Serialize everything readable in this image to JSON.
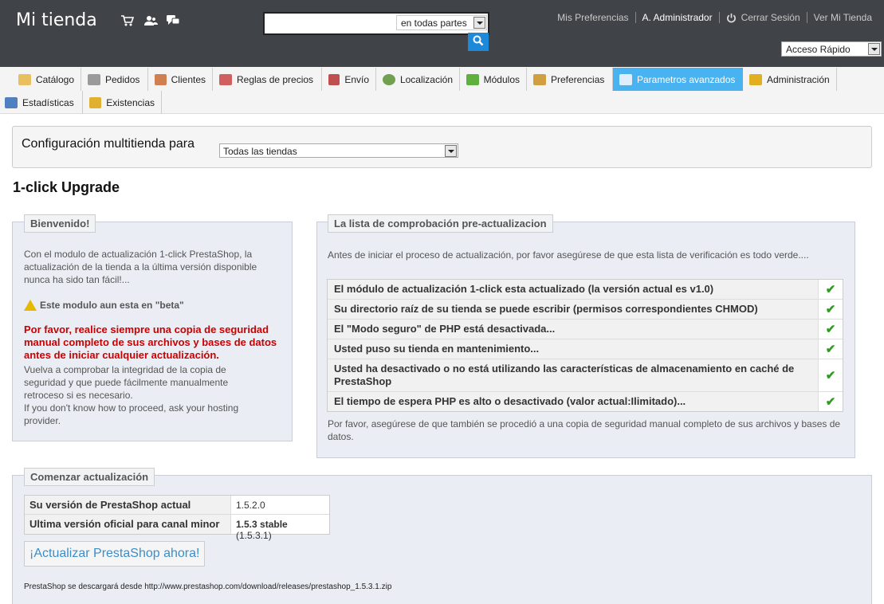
{
  "header": {
    "shop_name": "Mi tienda",
    "search": {
      "placeholder": "",
      "scope": "en todas partes"
    },
    "links": {
      "preferences": "Mis Preferencias",
      "admin": "A. Administrador",
      "logout": "Cerrar Sesión",
      "view_shop": "Ver Mi Tienda"
    },
    "quick_access": "Acceso Rápido"
  },
  "nav": {
    "tabs": [
      {
        "label": "Catálogo",
        "icon": "folder-icon",
        "color": "#e8c060"
      },
      {
        "label": "Pedidos",
        "icon": "cart-icon",
        "color": "#9a9a9a"
      },
      {
        "label": "Clientes",
        "icon": "user-icon",
        "color": "#d08050"
      },
      {
        "label": "Reglas de precios",
        "icon": "price-rules-icon",
        "color": "#d06060"
      },
      {
        "label": "Envío",
        "icon": "truck-icon",
        "color": "#c05050"
      },
      {
        "label": "Localización",
        "icon": "globe-icon",
        "color": "#70a050"
      },
      {
        "label": "Módulos",
        "icon": "puzzle-icon",
        "color": "#60b040"
      },
      {
        "label": "Preferencias",
        "icon": "preferences-icon",
        "color": "#d0a040"
      },
      {
        "label": "Parametros avanzados",
        "icon": "wrench-icon",
        "color": "#e0eefc"
      },
      {
        "label": "Administración",
        "icon": "key-icon",
        "color": "#e0b020"
      },
      {
        "label": "Estadísticas",
        "icon": "stats-icon",
        "color": "#5080c0"
      },
      {
        "label": "Existencias",
        "icon": "stock-icon",
        "color": "#e0b030"
      }
    ]
  },
  "multishop": {
    "label": "Configuración multitienda para",
    "selected": "Todas las tiendas"
  },
  "page_title": "1-click Upgrade",
  "welcome": {
    "legend": "Bienvenido!",
    "intro": "Con el modulo de actualización 1-click PrestaShop, la actualización de la tienda a la última versión disponible nunca ha sido tan fácil!...",
    "beta": "Este modulo aun esta en \"beta\"",
    "warning": "Por favor, realice siempre una copia de seguridad manual completo de sus archivos y bases de datos antes de iniciar cualquier actualización.",
    "check_integrity": "Vuelva a comprobar la integridad de la copia de seguridad y que puede fácilmente manualmente retroceso si es necesario.",
    "help": "If you don't know how to proceed, ask your hosting provider."
  },
  "checklist": {
    "legend": "La lista de comprobación pre-actualizacion",
    "intro": "Antes de iniciar el proceso de actualización, por favor asegúrese de que esta lista de verificación es todo verde....",
    "items": [
      {
        "text": "El módulo de actualización 1-click esta actualizado (la versión actual es v1.0)",
        "status": "✔"
      },
      {
        "text": "Su directorio raíz de su tienda se puede escribir (permisos correspondientes CHMOD)",
        "status": "✔"
      },
      {
        "text": "El \"Modo seguro\" de PHP está desactivada...",
        "status": "✔"
      },
      {
        "text": "Usted puso su tienda en mantenimiento...",
        "status": "✔"
      },
      {
        "text": "Usted ha desactivado o no está utilizando las características de almacenamiento en caché de PrestaShop",
        "status": "✔"
      },
      {
        "text": "El tiempo de espera PHP es alto o desactivado (valor actual:Ilimitado)...",
        "status": "✔"
      }
    ],
    "outro": "Por favor, asegúrese de que también se procedió a una copia de seguridad manual completo de sus archivos y bases de datos."
  },
  "upgrade": {
    "legend": "Comenzar actualización",
    "current_label": "Su versión de PrestaShop actual",
    "current_value": "1.5.2.0",
    "latest_label": "Ultima versión oficial para canal minor",
    "latest_value_bold": "1.5.3 stable",
    "latest_value_extra": " (1.5.3.1)",
    "button": "¡Actualizar PrestaShop ahora!",
    "download_note": "PrestaShop se descargará desde http://www.prestashop.com/download/releases/prestashop_1.5.3.1.zip"
  }
}
